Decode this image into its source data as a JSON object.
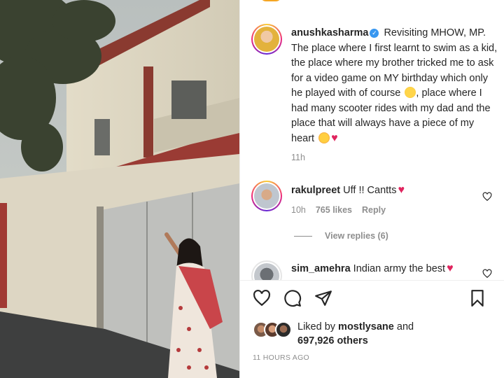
{
  "post": {
    "author": "anushkasharma",
    "caption_part1": "Revisiting MHOW, MP. The place where I first learnt to swim as a kid, the place where my brother tricked me to ask for a video game on MY birthday which only he played with of course",
    "caption_part2": ", place where I had many scooter rides with my dad and the place that will always have a piece of my heart",
    "time": "11h"
  },
  "comments": [
    {
      "username": "rakulpreet",
      "text": "Uff !! Cantts",
      "time": "10h",
      "likes": "765 likes",
      "reply_label": "Reply",
      "view_replies": "View replies (6)"
    },
    {
      "username": "sim_amehra",
      "text": "Indian army the best"
    }
  ],
  "likes": {
    "prefix": "Liked by",
    "user": "mostlysane",
    "conjunction": "and",
    "others": "697,926 others"
  },
  "timestamp": "11 HOURS AGO",
  "icons": [
    "heart-icon",
    "comment-icon",
    "share-icon",
    "bookmark-icon",
    "verified-badge-icon"
  ],
  "colors": {
    "verified": "#3897f0",
    "heart": "#e0245e",
    "muted": "#8e8e8e",
    "ring": [
      "#f9ce34",
      "#ee2a7b",
      "#6228d7"
    ]
  }
}
